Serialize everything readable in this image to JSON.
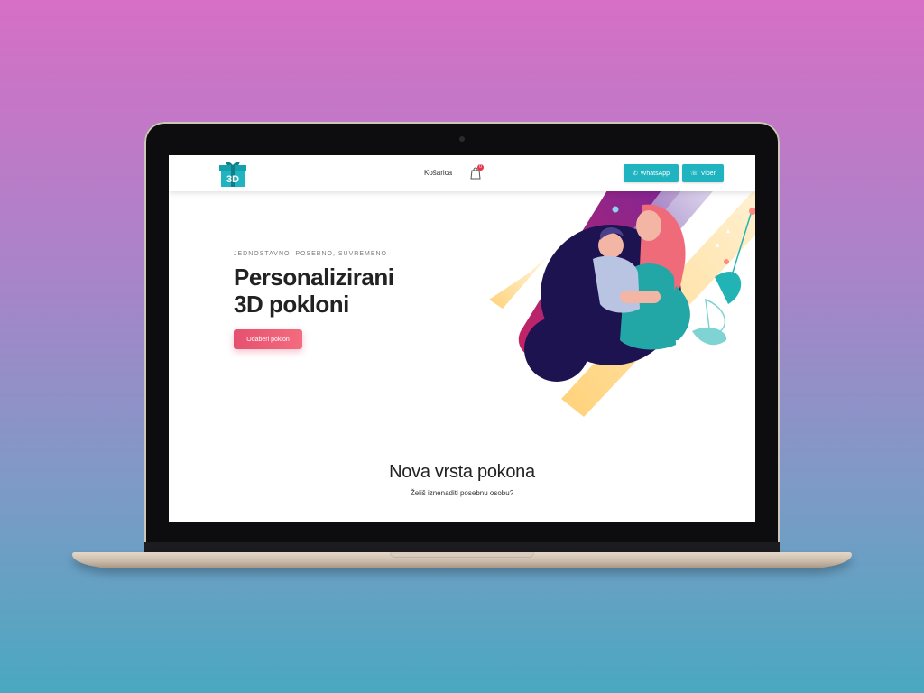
{
  "header": {
    "logo_text": "3D",
    "nav_cart": "Košarica",
    "cart_count": "0",
    "whatsapp_label": "WhatsApp",
    "viber_label": "Viber"
  },
  "hero": {
    "eyebrow": "JEDNOSTAVNO, POSEBNO, SUVREMENO",
    "title_line1": "Personalizirani",
    "title_line2": "3D pokloni",
    "cta_label": "Odaberi poklon"
  },
  "section": {
    "title": "Nova vrsta pokona",
    "subtitle": "Želiš iznenaditi posebnu osobu?"
  },
  "colors": {
    "brand_teal": "#1fb4bf",
    "cta_pink": "#e6506f",
    "badge_red": "#e8344a"
  }
}
